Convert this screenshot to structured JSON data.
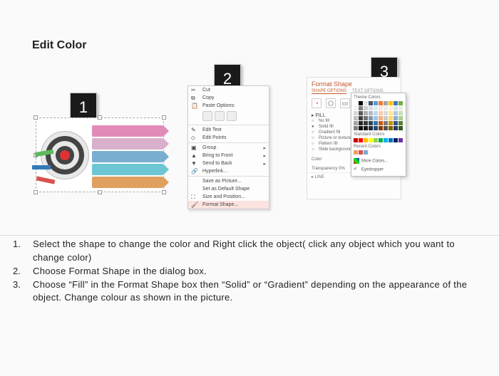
{
  "title": "Edit Color",
  "badges": {
    "one": "1",
    "two": "2",
    "three": "3"
  },
  "context_menu": {
    "cut": "Cut",
    "copy": "Copy",
    "paste_options": "Paste Options:",
    "edit_text": "Edit Text",
    "edit_points": "Edit Points",
    "group": "Group",
    "bring_to_front": "Bring to Front",
    "send_to_back": "Send to Back",
    "hyperlink": "Hyperlink...",
    "save_as_picture": "Save as Picture...",
    "set_default": "Set as Default Shape",
    "size_position": "Size and Position...",
    "format_shape": "Format Shape..."
  },
  "format_pane": {
    "title": "Format Shape",
    "tab_shape": "SHAPE OPTIONS",
    "tab_text": "TEXT OPTIONS",
    "fill_header": "▸ FILL",
    "no_fill": "No fill",
    "solid_fill": "Solid fill",
    "gradient_fill": "Gradient fill",
    "picture_fill": "Picture or texture fill",
    "pattern_fill": "Pattern fill",
    "slide_fill": "Slide background fill",
    "color_label": "Color",
    "transparency": "Transparency   0%",
    "line_header": "▸ LINE"
  },
  "color_picker": {
    "theme": "Theme Colors",
    "standard": "Standard Colors",
    "recent": "Recent Colors",
    "more": "More Colors...",
    "eyedropper": "Eyedropper"
  },
  "theme_colors": [
    "#ffffff",
    "#000000",
    "#e7e6e6",
    "#44546a",
    "#5b9bd5",
    "#ed7d31",
    "#a5a5a5",
    "#ffc000",
    "#4472c4",
    "#70ad47",
    "#f2f2f2",
    "#7f7f7f",
    "#d0cece",
    "#d6dce4",
    "#deebf6",
    "#fbe5d5",
    "#ededed",
    "#fff2cc",
    "#d9e2f3",
    "#e2efd9",
    "#d8d8d8",
    "#595959",
    "#aeabab",
    "#adb9ca",
    "#bdd7ee",
    "#f7cbac",
    "#dbdbdb",
    "#fee599",
    "#b4c6e7",
    "#c5e0b3",
    "#bfbfbf",
    "#3f3f3f",
    "#757070",
    "#8496b0",
    "#9cc3e5",
    "#f4b183",
    "#c9c9c9",
    "#ffd965",
    "#8eaadb",
    "#a8d08d",
    "#a5a5a5",
    "#262626",
    "#3a3838",
    "#323f4f",
    "#2e75b5",
    "#c55a11",
    "#7b7b7b",
    "#bf9000",
    "#2f5496",
    "#538135",
    "#7f7f7f",
    "#0c0c0c",
    "#171616",
    "#222a35",
    "#1e4e79",
    "#833c0b",
    "#525252",
    "#7f6000",
    "#1f3864",
    "#375623"
  ],
  "standard_colors": [
    "#c00000",
    "#ff0000",
    "#ffc000",
    "#ffff00",
    "#92d050",
    "#00b050",
    "#00b0f0",
    "#0070c0",
    "#002060",
    "#7030a0"
  ],
  "recent_colors": [
    "#f0a060",
    "#d9534f",
    "#7aaed0"
  ],
  "instructions": {
    "i1_num": "1.",
    "i1_txt": "Select the shape to change the color and Right click the object( click any object which you want to change color)",
    "i2_num": "2.",
    "i2_txt": "Choose Format Shape in the dialog box.",
    "i3_num": "3.",
    "i3_txt": "Choose “Fill” in the Format Shape box then “Solid” or “Gradient” depending on the appearance of the object. Change colour as shown in the picture."
  }
}
